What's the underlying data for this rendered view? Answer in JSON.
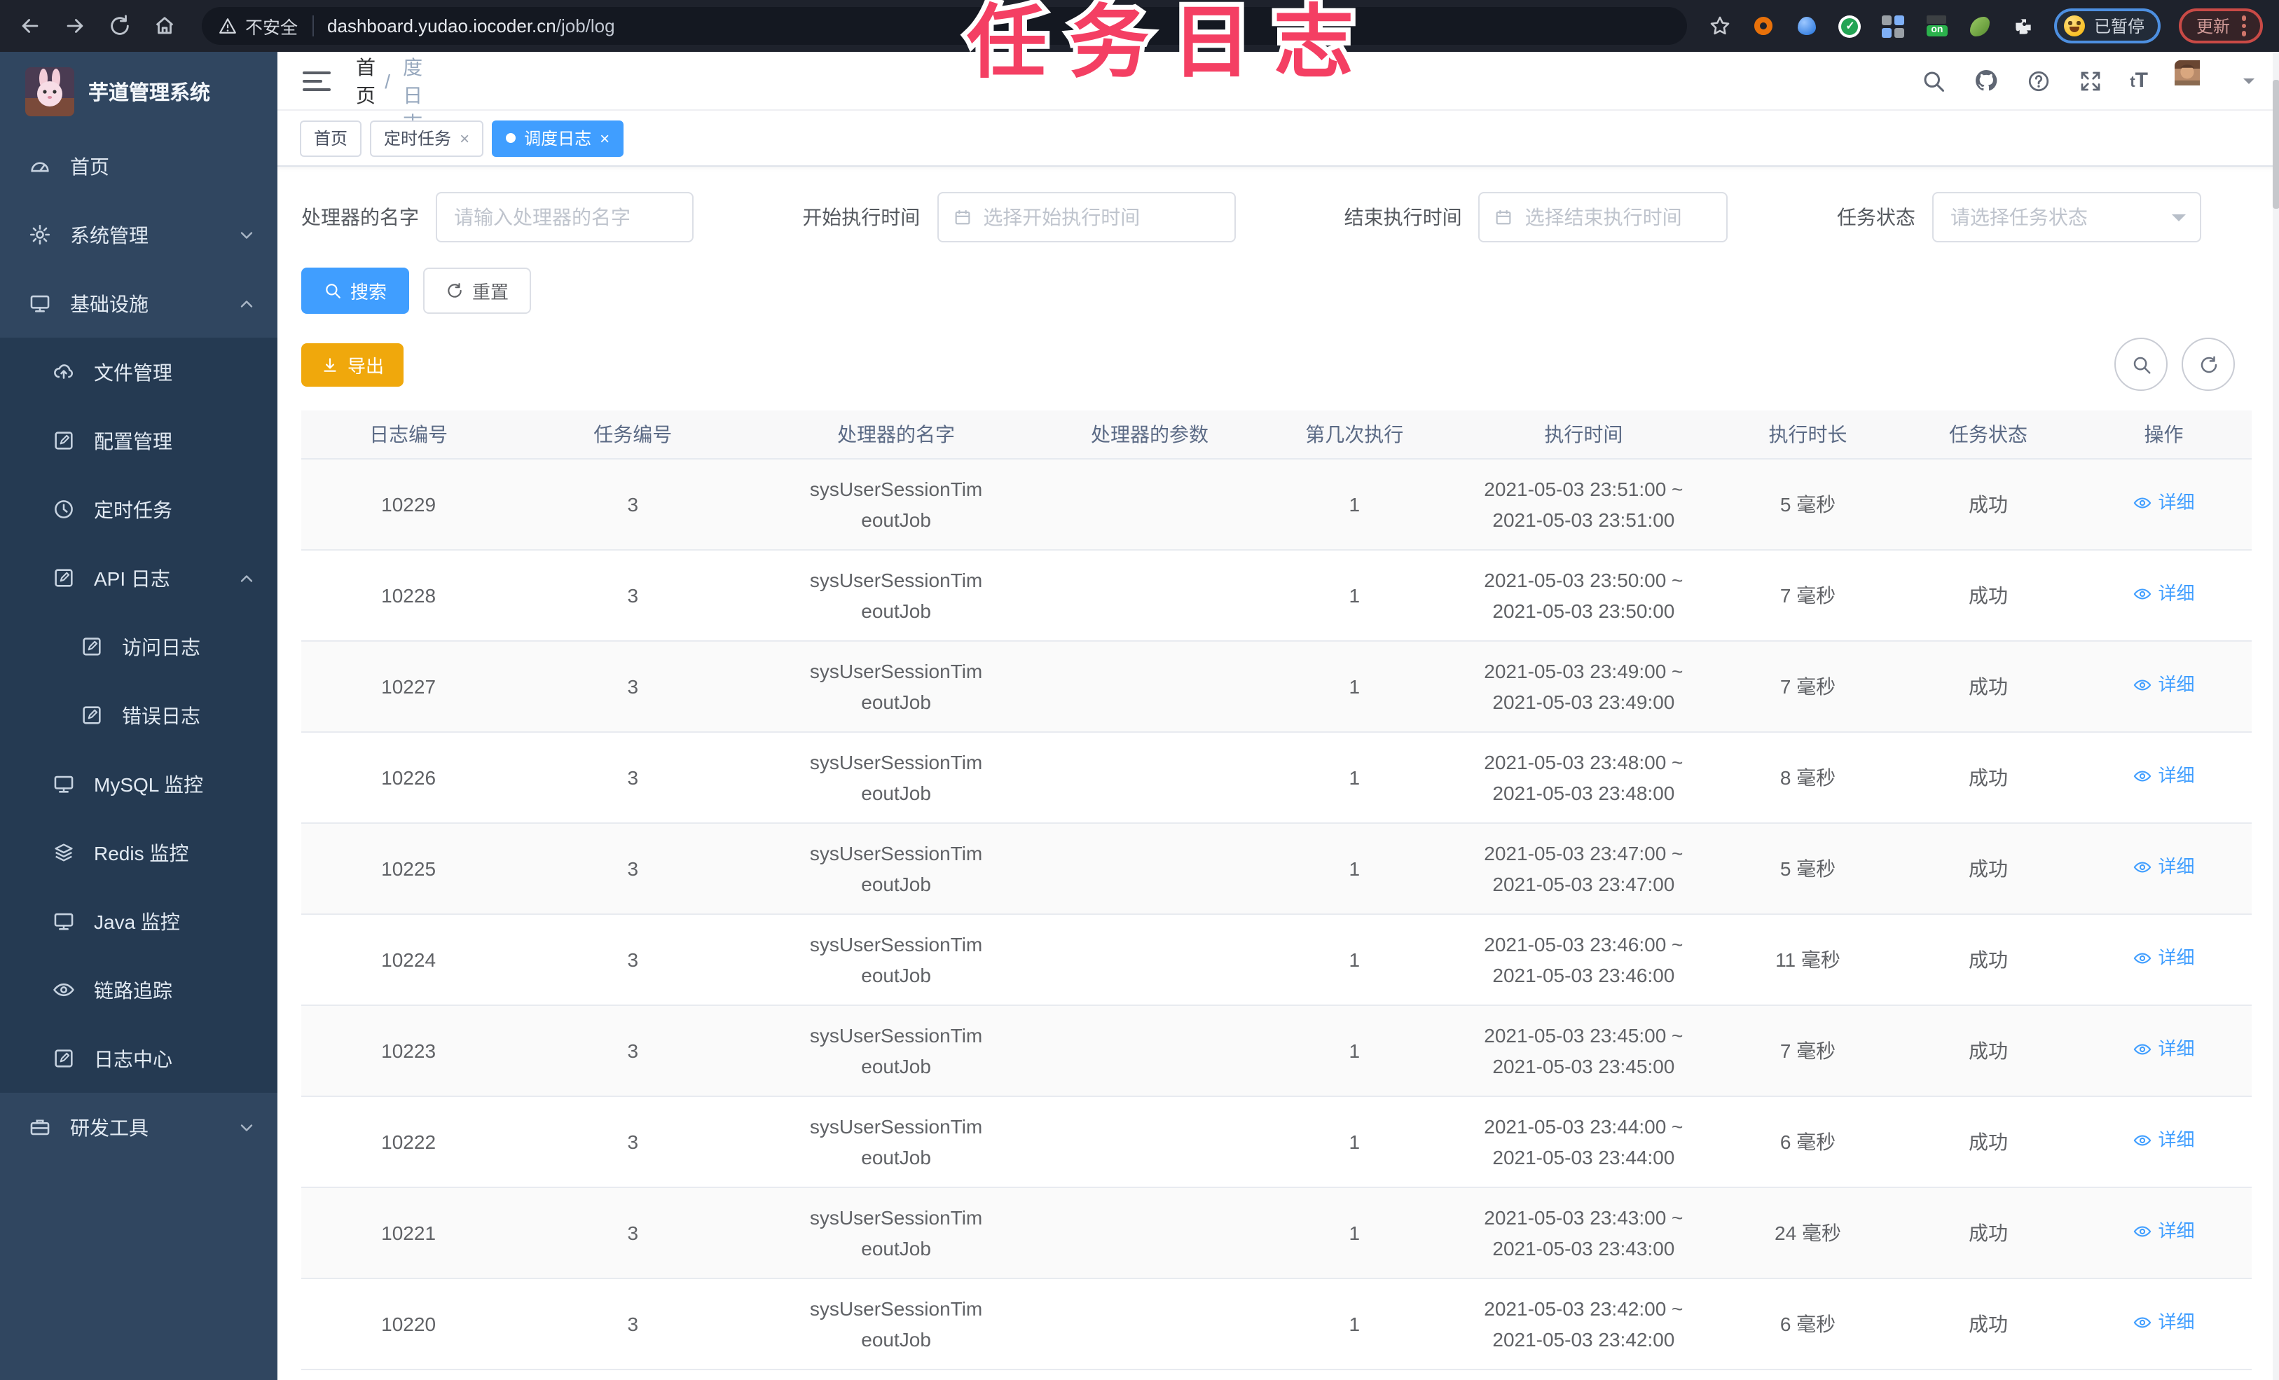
{
  "browser": {
    "security_label": "不安全",
    "url_host": "dashboard.yudao.iocoder.cn",
    "url_path": "/job/log",
    "paused_badge": "已暂停",
    "update_label": "更新"
  },
  "watermark": "任务日志",
  "sidebar": {
    "logo_title": "芋道管理系统",
    "items": [
      {
        "label": "首页",
        "icon": "dashboard-icon",
        "level": 1,
        "submenu": false,
        "chevron": ""
      },
      {
        "label": "系统管理",
        "icon": "gear-icon",
        "level": 1,
        "submenu": false,
        "chevron": "down"
      },
      {
        "label": "基础设施",
        "icon": "monitor-icon",
        "level": 1,
        "submenu": false,
        "chevron": "up"
      },
      {
        "label": "文件管理",
        "icon": "cloud-upload-icon",
        "level": 2,
        "submenu": true,
        "chevron": ""
      },
      {
        "label": "配置管理",
        "icon": "edit-icon",
        "level": 2,
        "submenu": true,
        "chevron": ""
      },
      {
        "label": "定时任务",
        "icon": "clock-icon",
        "level": 2,
        "submenu": true,
        "chevron": ""
      },
      {
        "label": "API 日志",
        "icon": "edit-icon",
        "level": 2,
        "submenu": true,
        "chevron": "up"
      },
      {
        "label": "访问日志",
        "icon": "edit-icon",
        "level": 3,
        "submenu": true,
        "chevron": ""
      },
      {
        "label": "错误日志",
        "icon": "edit-icon",
        "level": 3,
        "submenu": true,
        "chevron": ""
      },
      {
        "label": "MySQL 监控",
        "icon": "monitor-icon",
        "level": 2,
        "submenu": true,
        "chevron": ""
      },
      {
        "label": "Redis 监控",
        "icon": "layers-icon",
        "level": 2,
        "submenu": true,
        "chevron": ""
      },
      {
        "label": "Java 监控",
        "icon": "monitor-icon",
        "level": 2,
        "submenu": true,
        "chevron": ""
      },
      {
        "label": "链路追踪",
        "icon": "eye-icon",
        "level": 2,
        "submenu": true,
        "chevron": ""
      },
      {
        "label": "日志中心",
        "icon": "edit-icon",
        "level": 2,
        "submenu": true,
        "chevron": ""
      },
      {
        "label": "研发工具",
        "icon": "briefcase-icon",
        "level": 1,
        "submenu": false,
        "chevron": "down"
      }
    ]
  },
  "header": {
    "breadcrumb": [
      "首页",
      "调度日志"
    ]
  },
  "tabs": [
    {
      "label": "首页",
      "closable": false,
      "active": false
    },
    {
      "label": "定时任务",
      "closable": true,
      "active": false
    },
    {
      "label": "调度日志",
      "closable": true,
      "active": true
    }
  ],
  "filters": {
    "handler_name": {
      "label": "处理器的名字",
      "placeholder": "请输入处理器的名字",
      "value": ""
    },
    "begin_time": {
      "label": "开始执行时间",
      "placeholder": "选择开始执行时间",
      "value": ""
    },
    "end_time": {
      "label": "结束执行时间",
      "placeholder": "选择结束执行时间",
      "value": ""
    },
    "status": {
      "label": "任务状态",
      "placeholder": "请选择任务状态",
      "value": ""
    }
  },
  "buttons": {
    "search": "搜索",
    "reset": "重置",
    "export": "导出"
  },
  "table": {
    "headers": [
      "日志编号",
      "任务编号",
      "处理器的名字",
      "处理器的参数",
      "第几次执行",
      "执行时间",
      "执行时长",
      "任务状态",
      "操作"
    ],
    "action_label": "详细",
    "rows": [
      {
        "log_id": "10229",
        "task_id": "3",
        "handler": [
          "sysUserSessionTim",
          "eoutJob"
        ],
        "param": "",
        "count": "1",
        "time": [
          "2021-05-03 23:51:00 ~",
          "2021-05-03 23:51:00"
        ],
        "duration": "5 毫秒",
        "status": "成功"
      },
      {
        "log_id": "10228",
        "task_id": "3",
        "handler": [
          "sysUserSessionTim",
          "eoutJob"
        ],
        "param": "",
        "count": "1",
        "time": [
          "2021-05-03 23:50:00 ~",
          "2021-05-03 23:50:00"
        ],
        "duration": "7 毫秒",
        "status": "成功"
      },
      {
        "log_id": "10227",
        "task_id": "3",
        "handler": [
          "sysUserSessionTim",
          "eoutJob"
        ],
        "param": "",
        "count": "1",
        "time": [
          "2021-05-03 23:49:00 ~",
          "2021-05-03 23:49:00"
        ],
        "duration": "7 毫秒",
        "status": "成功"
      },
      {
        "log_id": "10226",
        "task_id": "3",
        "handler": [
          "sysUserSessionTim",
          "eoutJob"
        ],
        "param": "",
        "count": "1",
        "time": [
          "2021-05-03 23:48:00 ~",
          "2021-05-03 23:48:00"
        ],
        "duration": "8 毫秒",
        "status": "成功"
      },
      {
        "log_id": "10225",
        "task_id": "3",
        "handler": [
          "sysUserSessionTim",
          "eoutJob"
        ],
        "param": "",
        "count": "1",
        "time": [
          "2021-05-03 23:47:00 ~",
          "2021-05-03 23:47:00"
        ],
        "duration": "5 毫秒",
        "status": "成功"
      },
      {
        "log_id": "10224",
        "task_id": "3",
        "handler": [
          "sysUserSessionTim",
          "eoutJob"
        ],
        "param": "",
        "count": "1",
        "time": [
          "2021-05-03 23:46:00 ~",
          "2021-05-03 23:46:00"
        ],
        "duration": "11 毫秒",
        "status": "成功"
      },
      {
        "log_id": "10223",
        "task_id": "3",
        "handler": [
          "sysUserSessionTim",
          "eoutJob"
        ],
        "param": "",
        "count": "1",
        "time": [
          "2021-05-03 23:45:00 ~",
          "2021-05-03 23:45:00"
        ],
        "duration": "7 毫秒",
        "status": "成功"
      },
      {
        "log_id": "10222",
        "task_id": "3",
        "handler": [
          "sysUserSessionTim",
          "eoutJob"
        ],
        "param": "",
        "count": "1",
        "time": [
          "2021-05-03 23:44:00 ~",
          "2021-05-03 23:44:00"
        ],
        "duration": "6 毫秒",
        "status": "成功"
      },
      {
        "log_id": "10221",
        "task_id": "3",
        "handler": [
          "sysUserSessionTim",
          "eoutJob"
        ],
        "param": "",
        "count": "1",
        "time": [
          "2021-05-03 23:43:00 ~",
          "2021-05-03 23:43:00"
        ],
        "duration": "24 毫秒",
        "status": "成功"
      },
      {
        "log_id": "10220",
        "task_id": "3",
        "handler": [
          "sysUserSessionTim",
          "eoutJob"
        ],
        "param": "",
        "count": "1",
        "time": [
          "2021-05-03 23:42:00 ~",
          "2021-05-03 23:42:00"
        ],
        "duration": "6 毫秒",
        "status": "成功"
      }
    ]
  },
  "colors": {
    "accent": "#409eff",
    "warning": "#f0a80c",
    "watermark": "#f43f63",
    "sidebar_bg": "#304660",
    "sidebar_submenu_bg": "#253a52"
  }
}
